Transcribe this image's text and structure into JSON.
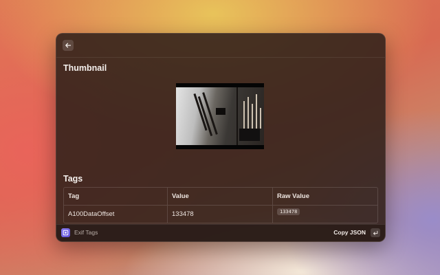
{
  "header": {
    "back_icon": "arrow-left-icon"
  },
  "thumbnail": {
    "title": "Thumbnail"
  },
  "tags": {
    "title": "Tags",
    "columns": [
      "Tag",
      "Value",
      "Raw Value"
    ],
    "rows": [
      {
        "tag": "A100DataOffset",
        "value": "133478",
        "raw": "133478"
      }
    ]
  },
  "footer": {
    "app_name": "Exif Tags",
    "app_icon": "exif-app-icon",
    "action_label": "Copy JSON",
    "action_key_icon": "enter-key-icon"
  }
}
